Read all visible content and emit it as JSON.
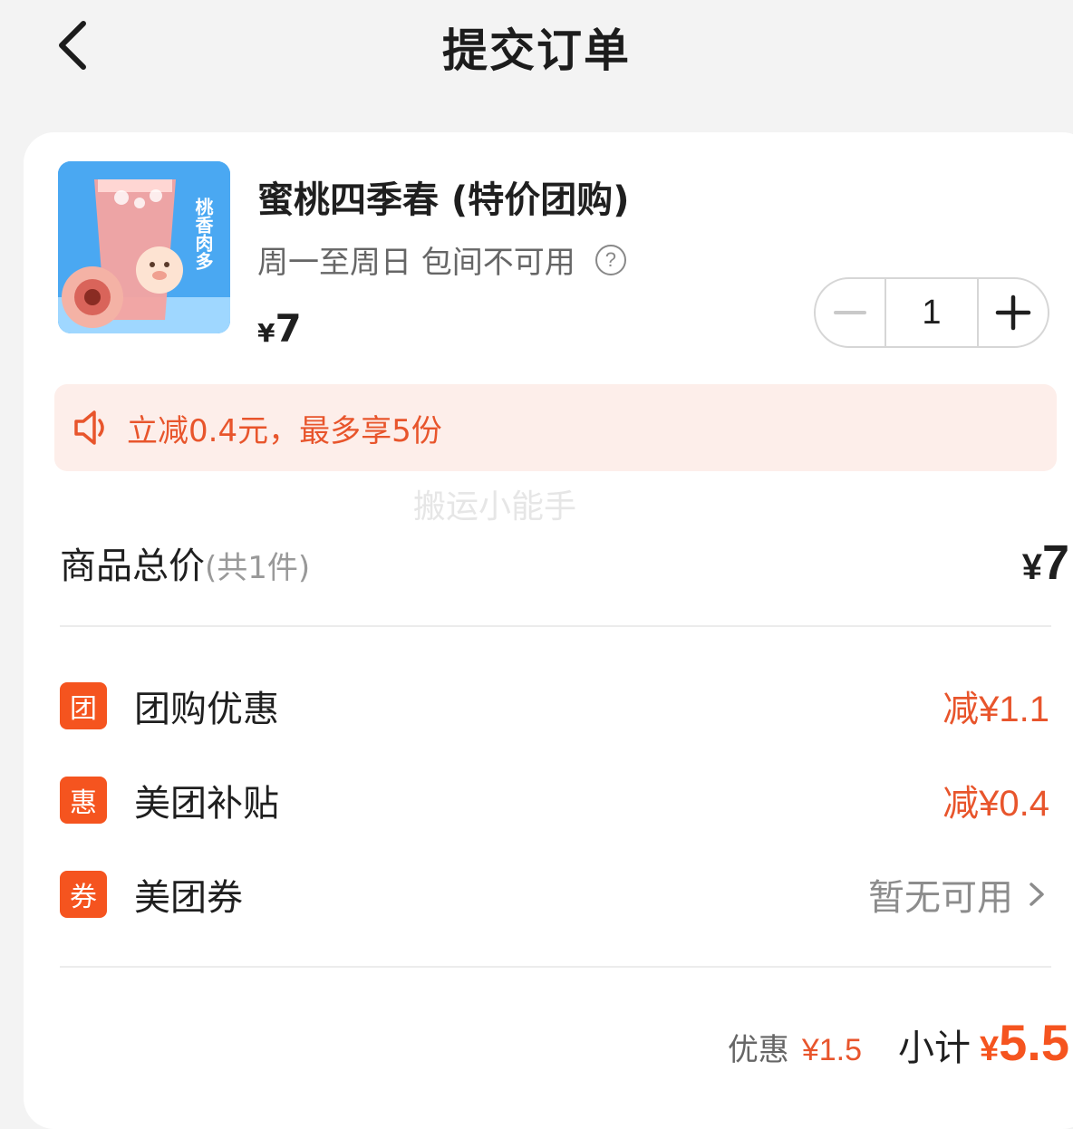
{
  "header": {
    "title": "提交订单",
    "back_icon": "chevron-left-icon"
  },
  "product": {
    "name": "蜜桃四季春 (特价团购)",
    "subtitle": "周一至周日 包间不可用",
    "help_icon_glyph": "?",
    "price_currency": "¥",
    "price": "7",
    "image_text": "桃香肉多",
    "quantity": "1"
  },
  "promo": {
    "icon": "speaker-icon",
    "text": "立减0.4元，最多享5份",
    "color": "#e8552c",
    "background": "#fdeeea"
  },
  "watermark": "搬运小能手",
  "total": {
    "label": "商品总价",
    "count": "(共1件)",
    "currency": "¥",
    "value": "7"
  },
  "discounts": [
    {
      "badge": "团",
      "label": "团购优惠",
      "value": "减¥1.1"
    },
    {
      "badge": "惠",
      "label": "美团补贴",
      "value": "减¥0.4"
    },
    {
      "badge": "券",
      "label": "美团券",
      "value": "暂无可用"
    }
  ],
  "summary": {
    "discount_label": "优惠",
    "discount_value": "¥1.5",
    "subtotal_label": "小计",
    "subtotal_currency": "¥",
    "subtotal_value": "5.5"
  },
  "colors": {
    "accent": "#f5541f",
    "discount_text": "#e8552c",
    "background": "#f3f3f3"
  }
}
